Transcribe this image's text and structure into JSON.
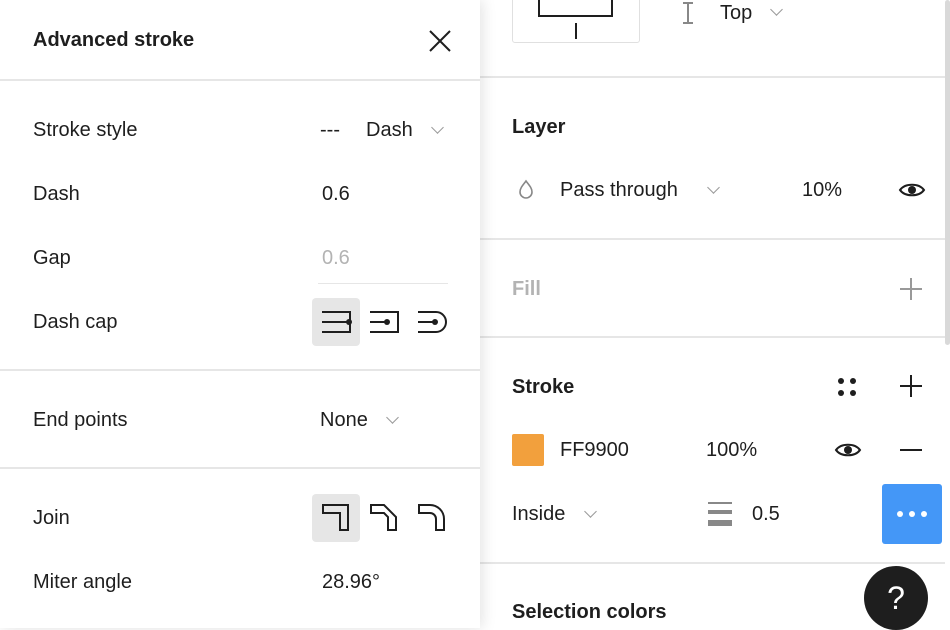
{
  "advanced_stroke": {
    "title": "Advanced stroke",
    "stroke_style": {
      "label": "Stroke style",
      "value": "Dash",
      "preview": "---"
    },
    "dash": {
      "label": "Dash",
      "value": "0.6"
    },
    "gap": {
      "label": "Gap",
      "placeholder": "0.6"
    },
    "dash_cap": {
      "label": "Dash cap",
      "options": [
        "square-cap",
        "flat-cap",
        "round-cap"
      ],
      "selected": "square-cap"
    },
    "end_points": {
      "label": "End points",
      "value": "None"
    },
    "join": {
      "label": "Join",
      "options": [
        "miter-join",
        "bevel-join",
        "round-join"
      ],
      "selected": "miter-join"
    },
    "miter_angle": {
      "label": "Miter angle",
      "value": "28.96°"
    }
  },
  "right": {
    "constraint_vertical": "Top",
    "layer": {
      "title": "Layer",
      "blend": "Pass through",
      "opacity": "10%"
    },
    "fill": {
      "title": "Fill"
    },
    "stroke": {
      "title": "Stroke",
      "color_hex": "FF9900",
      "swatch": "#F2A03D",
      "opacity": "100%",
      "position": "Inside",
      "weight": "0.5",
      "accent": "#4497F7"
    },
    "selection_colors": {
      "title": "Selection colors"
    }
  },
  "help": "?"
}
